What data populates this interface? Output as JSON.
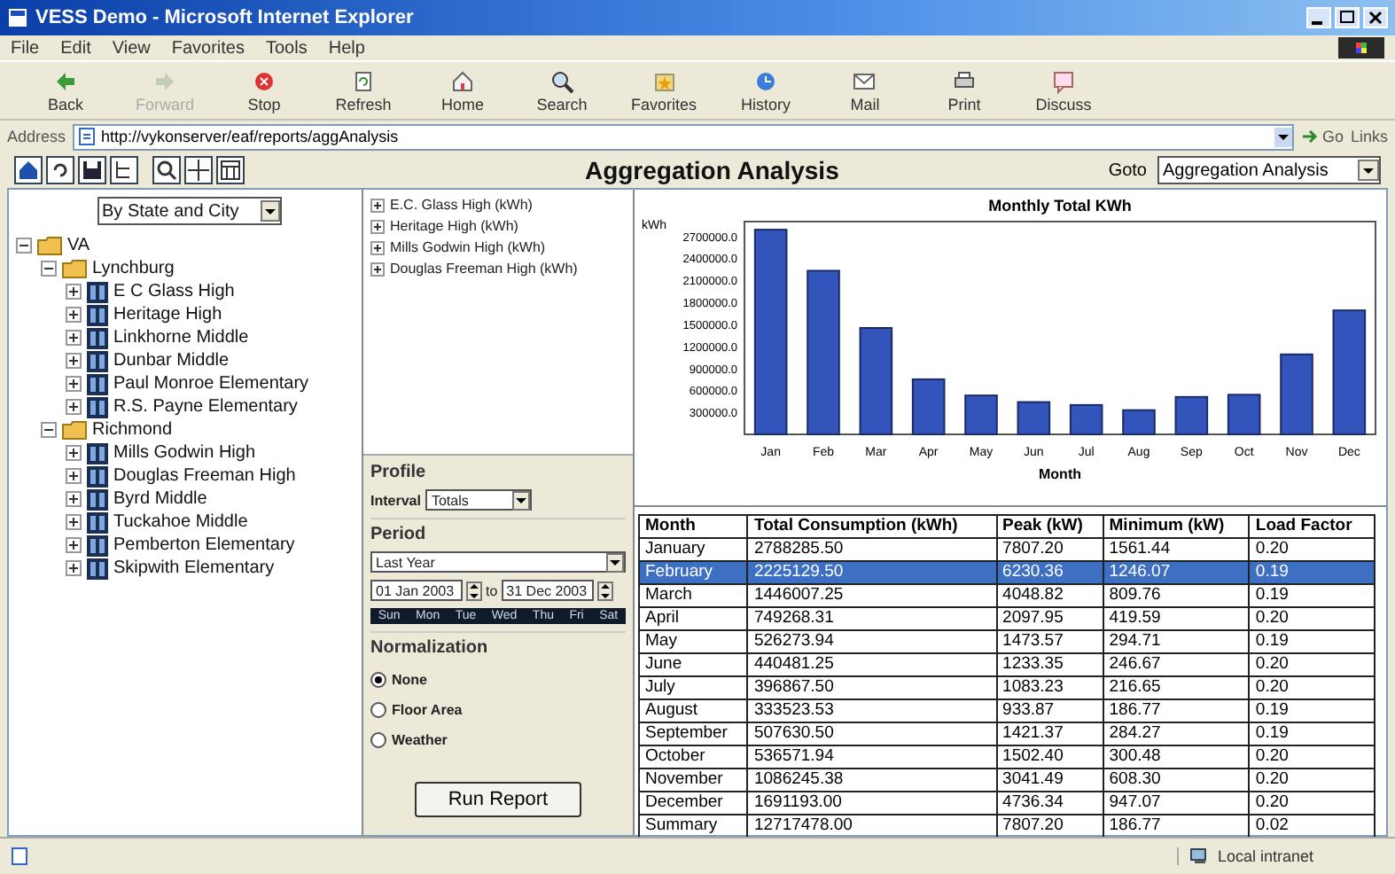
{
  "window": {
    "title": "VESS Demo - Microsoft Internet Explorer"
  },
  "menu": [
    "File",
    "Edit",
    "View",
    "Favorites",
    "Tools",
    "Help"
  ],
  "toolbar": [
    {
      "kind": "back",
      "label": "Back",
      "disabled": false
    },
    {
      "kind": "forward",
      "label": "Forward",
      "disabled": true
    },
    {
      "kind": "stop",
      "label": "Stop",
      "disabled": false
    },
    {
      "kind": "refresh",
      "label": "Refresh",
      "disabled": false
    },
    {
      "kind": "home",
      "label": "Home",
      "disabled": false
    },
    {
      "kind": "search",
      "label": "Search",
      "disabled": false
    },
    {
      "kind": "favorites",
      "label": "Favorites",
      "disabled": false
    },
    {
      "kind": "history",
      "label": "History",
      "disabled": false
    },
    {
      "kind": "mail",
      "label": "Mail",
      "disabled": false
    },
    {
      "kind": "print",
      "label": "Print",
      "disabled": false
    },
    {
      "kind": "discuss",
      "label": "Discuss",
      "disabled": false
    }
  ],
  "address": {
    "label": "Address",
    "url": "http://vykonserver/eaf/reports/aggAnalysis",
    "go": "Go",
    "links": "Links"
  },
  "app_header": {
    "title": "Aggregation Analysis",
    "goto_label": "Goto",
    "goto_value": "Aggregation Analysis"
  },
  "tree": {
    "grouping": "By State and City",
    "items": [
      {
        "label": "VA",
        "kind": "folder",
        "expanded": true,
        "children": [
          {
            "label": "Lynchburg",
            "kind": "folder",
            "expanded": true,
            "children": [
              {
                "label": "E C Glass High",
                "kind": "building",
                "expanded": false
              },
              {
                "label": "Heritage High",
                "kind": "building",
                "expanded": false
              },
              {
                "label": "Linkhorne Middle",
                "kind": "building",
                "expanded": false
              },
              {
                "label": "Dunbar Middle",
                "kind": "building",
                "expanded": false
              },
              {
                "label": "Paul Monroe Elementary",
                "kind": "building",
                "expanded": false
              },
              {
                "label": "R.S. Payne Elementary",
                "kind": "building",
                "expanded": false
              }
            ]
          },
          {
            "label": "Richmond",
            "kind": "folder",
            "expanded": true,
            "children": [
              {
                "label": "Mills Godwin High",
                "kind": "building",
                "expanded": false
              },
              {
                "label": "Douglas Freeman High",
                "kind": "building",
                "expanded": false
              },
              {
                "label": "Byrd Middle",
                "kind": "building",
                "expanded": false
              },
              {
                "label": "Tuckahoe Middle",
                "kind": "building",
                "expanded": false
              },
              {
                "label": "Pemberton Elementary",
                "kind": "building",
                "expanded": false
              },
              {
                "label": "Skipwith Elementary",
                "kind": "building",
                "expanded": false
              }
            ]
          }
        ]
      }
    ]
  },
  "legend": [
    {
      "label": "E.C. Glass High (kWh)",
      "expanded": false
    },
    {
      "label": "Heritage High (kWh)",
      "expanded": false
    },
    {
      "label": "Mills Godwin High (kWh)",
      "expanded": false
    },
    {
      "label": "Douglas Freeman High (kWh)",
      "expanded": false
    }
  ],
  "profile": {
    "heading": "Profile",
    "interval_label": "Interval",
    "interval_value": "Totals"
  },
  "period": {
    "heading": "Period",
    "preset": "Last Year",
    "from": "01 Jan 2003",
    "to_label": "to",
    "to": "31 Dec 2003",
    "weekdays": [
      "Sun",
      "Mon",
      "Tue",
      "Wed",
      "Thu",
      "Fri",
      "Sat"
    ]
  },
  "normalization": {
    "heading": "Normalization",
    "options": [
      {
        "label": "None",
        "selected": true
      },
      {
        "label": "Floor Area",
        "selected": false
      },
      {
        "label": "Weather",
        "selected": false
      }
    ]
  },
  "run_button": "Run Report",
  "chart": {
    "chart_data": {
      "type": "bar",
      "title": "Monthly Total KWh",
      "xlabel": "Month",
      "ylabel": "kWh",
      "categories": [
        "Jan",
        "Feb",
        "Mar",
        "Apr",
        "May",
        "Jun",
        "Jul",
        "Aug",
        "Sep",
        "Oct",
        "Nov",
        "Dec"
      ],
      "series": [
        {
          "color": "#3355bb",
          "values": [
            2790000,
            2230000,
            1450000,
            750000,
            530000,
            440000,
            400000,
            330000,
            510000,
            540000,
            1090000,
            1690000
          ]
        }
      ],
      "ylim": [
        0,
        2900000
      ],
      "yticks": [
        {
          "value": 300000,
          "label": "300000.0"
        },
        {
          "value": 600000,
          "label": "600000.0"
        },
        {
          "value": 900000,
          "label": "900000.0"
        },
        {
          "value": 1200000,
          "label": "1200000.0"
        },
        {
          "value": 1500000,
          "label": "1500000.0"
        },
        {
          "value": 1800000,
          "label": "1800000.0"
        },
        {
          "value": 2100000,
          "label": "2100000.0"
        },
        {
          "value": 2400000,
          "label": "2400000.0"
        },
        {
          "value": 2700000,
          "label": "2700000.0"
        }
      ]
    }
  },
  "table": {
    "columns": [
      "Month",
      "Total Consumption (kWh)",
      "Peak (kW)",
      "Minimum (kW)",
      "Load Factor"
    ],
    "rows": [
      {
        "cells": [
          "January",
          "2788285.50",
          "7807.20",
          "1561.44",
          "0.20"
        ],
        "selected": false
      },
      {
        "cells": [
          "February",
          "2225129.50",
          "6230.36",
          "1246.07",
          "0.19"
        ],
        "selected": true
      },
      {
        "cells": [
          "March",
          "1446007.25",
          "4048.82",
          "809.76",
          "0.19"
        ],
        "selected": false
      },
      {
        "cells": [
          "April",
          "749268.31",
          "2097.95",
          "419.59",
          "0.20"
        ],
        "selected": false
      },
      {
        "cells": [
          "May",
          "526273.94",
          "1473.57",
          "294.71",
          "0.19"
        ],
        "selected": false
      },
      {
        "cells": [
          "June",
          "440481.25",
          "1233.35",
          "246.67",
          "0.20"
        ],
        "selected": false
      },
      {
        "cells": [
          "July",
          "396867.50",
          "1083.23",
          "216.65",
          "0.20"
        ],
        "selected": false
      },
      {
        "cells": [
          "August",
          "333523.53",
          "933.87",
          "186.77",
          "0.19"
        ],
        "selected": false
      },
      {
        "cells": [
          "September",
          "507630.50",
          "1421.37",
          "284.27",
          "0.19"
        ],
        "selected": false
      },
      {
        "cells": [
          "October",
          "536571.94",
          "1502.40",
          "300.48",
          "0.20"
        ],
        "selected": false
      },
      {
        "cells": [
          "November",
          "1086245.38",
          "3041.49",
          "608.30",
          "0.20"
        ],
        "selected": false
      },
      {
        "cells": [
          "December",
          "1691193.00",
          "4736.34",
          "947.07",
          "0.20"
        ],
        "selected": false
      },
      {
        "cells": [
          "Summary",
          "12717478.00",
          "7807.20",
          "186.77",
          "0.02"
        ],
        "selected": false
      }
    ]
  },
  "status_bar": {
    "zone": "Local intranet"
  }
}
